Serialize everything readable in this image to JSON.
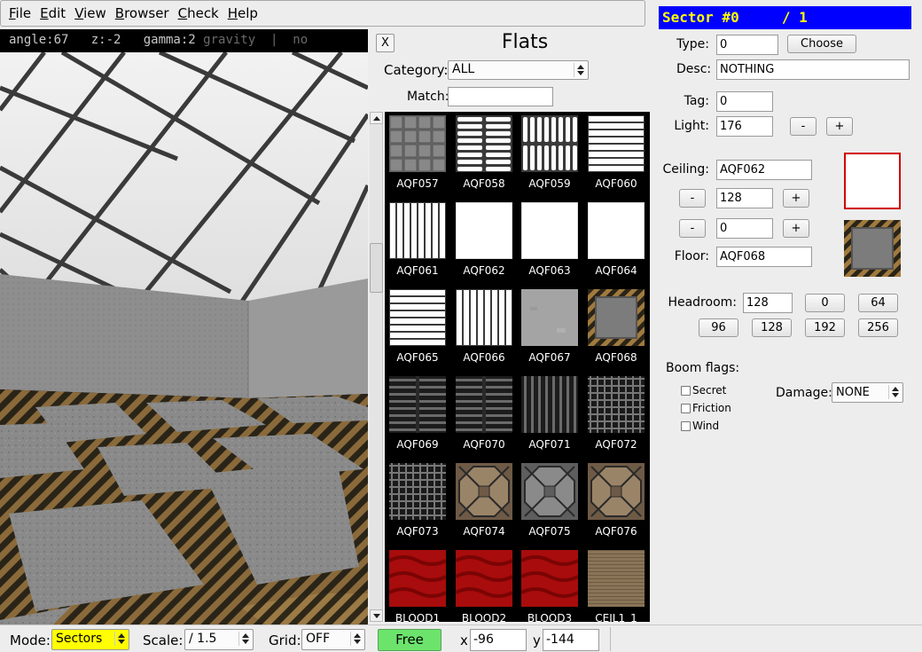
{
  "menu": {
    "items": [
      {
        "label": "File",
        "accel": "F",
        "rest": "ile"
      },
      {
        "label": "Edit",
        "accel": "E",
        "rest": "dit"
      },
      {
        "label": "View",
        "accel": "V",
        "rest": "iew"
      },
      {
        "label": "Browser",
        "accel": "B",
        "rest": "rowser"
      },
      {
        "label": "Check",
        "accel": "C",
        "rest": "heck"
      },
      {
        "label": "Help",
        "accel": "H",
        "rest": "elp"
      }
    ]
  },
  "viewport": {
    "status": "angle:67   z:-2   gamma:2 ",
    "status_dim": "gravity  |  no"
  },
  "browser": {
    "close_label": "X",
    "title": "Flats",
    "category_label": "Category:",
    "category_value": "ALL",
    "match_label": "Match:",
    "match_value": "",
    "flats": [
      {
        "name": "AQF057",
        "style": "stone-tiles"
      },
      {
        "name": "AQF058",
        "style": "h-slots"
      },
      {
        "name": "AQF059",
        "style": "v-slots-2row"
      },
      {
        "name": "AQF060",
        "style": "h-lines"
      },
      {
        "name": "AQF061",
        "style": "v-lines"
      },
      {
        "name": "AQF062",
        "style": "white"
      },
      {
        "name": "AQF063",
        "style": "white"
      },
      {
        "name": "AQF064",
        "style": "white"
      },
      {
        "name": "AQF065",
        "style": "h-lines"
      },
      {
        "name": "AQF066",
        "style": "v-lines"
      },
      {
        "name": "AQF067",
        "style": "grey-concrete"
      },
      {
        "name": "AQF068",
        "style": "hazard-frame"
      },
      {
        "name": "AQF069",
        "style": "dark-h-grate"
      },
      {
        "name": "AQF070",
        "style": "dark-h-grate"
      },
      {
        "name": "AQF071",
        "style": "dark-v-grate"
      },
      {
        "name": "AQF072",
        "style": "dark-mesh"
      },
      {
        "name": "AQF073",
        "style": "dark-mesh"
      },
      {
        "name": "AQF074",
        "style": "brown-octagon"
      },
      {
        "name": "AQF075",
        "style": "grey-octagon"
      },
      {
        "name": "AQF076",
        "style": "brown-octagon"
      },
      {
        "name": "BLOOD1",
        "style": "blood"
      },
      {
        "name": "BLOOD2",
        "style": "blood"
      },
      {
        "name": "BLOOD3",
        "style": "blood"
      },
      {
        "name": "CEIL1_1",
        "style": "wood"
      }
    ]
  },
  "sector": {
    "header": "Sector #0     / 1",
    "type_label": "Type:",
    "type_value": "0",
    "choose_label": "Choose",
    "desc_label": "Desc:",
    "desc_value": "NOTHING",
    "tag_label": "Tag:",
    "tag_value": "0",
    "light_label": "Light:",
    "light_value": "176",
    "minus": "-",
    "plus": "+",
    "ceiling_label": "Ceiling:",
    "ceiling_value": "AQF062",
    "ceiling_height": "128",
    "floor_height": "0",
    "floor_label": "Floor:",
    "floor_value": "AQF068",
    "headroom_label": "Headroom:",
    "headroom_value": "128",
    "headroom_presets": [
      "0",
      "64",
      "96",
      "128",
      "192",
      "256"
    ],
    "flags_label": "Boom flags:",
    "flags": [
      "Secret",
      "Friction",
      "Wind"
    ],
    "damage_label": "Damage:",
    "damage_value": "NONE"
  },
  "statusbar": {
    "mode_label": "Mode:",
    "mode_value": "Sectors",
    "scale_label": "Scale:",
    "scale_value": "/ 1.5",
    "grid_label": "Grid:",
    "grid_value": "OFF",
    "free_label": "Free",
    "x_label": "x",
    "x_value": "-96",
    "y_label": "y",
    "y_value": "-144"
  },
  "colors": {
    "sector_header_bg": "#0000ff",
    "sector_header_fg": "#ffff00",
    "mode_bg": "#ffff00",
    "free_bg": "#6ce46c",
    "ceiling_preview_border": "#d00000"
  }
}
